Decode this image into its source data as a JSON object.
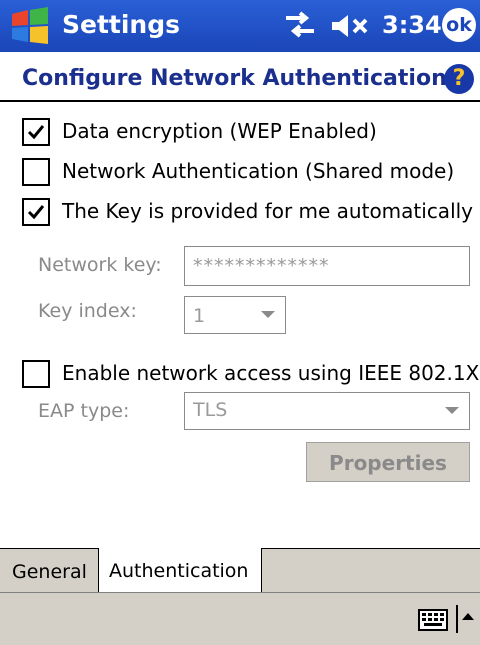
{
  "titlebar": {
    "app_title": "Settings",
    "clock": "3:34",
    "ok_label": "ok",
    "icons": [
      "windows-start-icon",
      "connectivity-icon",
      "volume-muted-icon"
    ]
  },
  "header": {
    "title": "Configure Network Authentication",
    "help_icon": "?"
  },
  "options": {
    "data_encryption": {
      "label": "Data encryption (WEP Enabled)",
      "checked": true
    },
    "network_auth": {
      "label": "Network Authentication (Shared mode)",
      "checked": false
    },
    "key_auto": {
      "label": "The Key is provided for me automatically",
      "checked": true
    },
    "ieee8021x": {
      "label": "Enable network access using IEEE 802.1X",
      "checked": false
    }
  },
  "fields": {
    "network_key_label": "Network key:",
    "network_key_value": "*************",
    "key_index_label": "Key index:",
    "key_index_value": "1",
    "eap_type_label": "EAP type:",
    "eap_type_value": "TLS",
    "properties_label": "Properties"
  },
  "tabs": [
    {
      "label": "General",
      "active": false
    },
    {
      "label": "Authentication",
      "active": true
    }
  ],
  "colors": {
    "titlebar": "#1a46b8",
    "title_text": "#1b2f8e",
    "disabled_text": "#8a8a8a",
    "tab_bg": "#d4d0c8"
  }
}
